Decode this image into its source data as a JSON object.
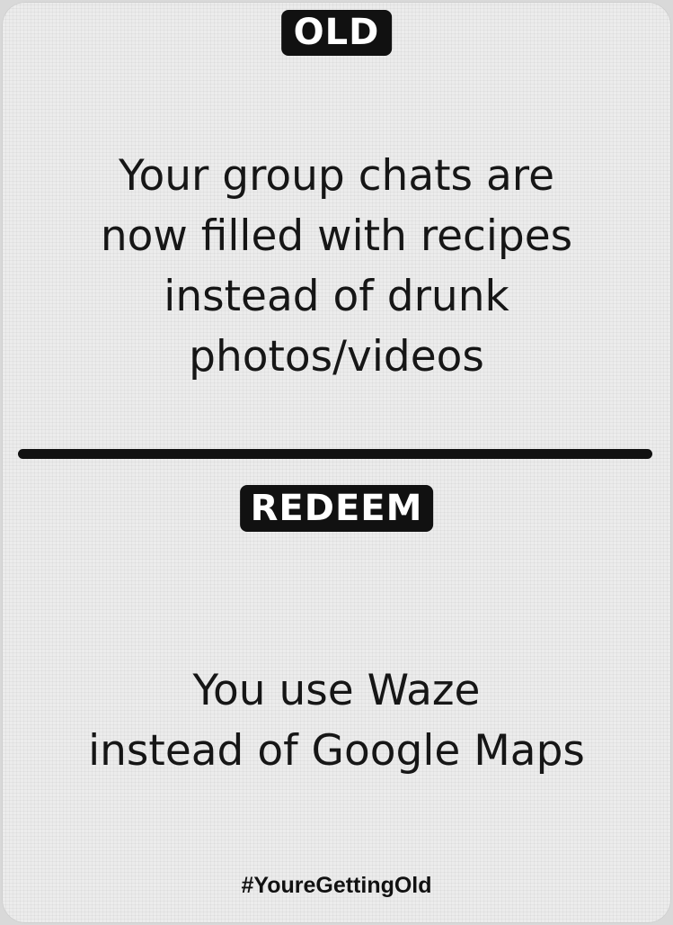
{
  "card": {
    "old_label": "OLD",
    "old_text": "Your group chats are\nnow filled with recipes\ninstead of drunk\nphotos/videos",
    "redeem_label": "REDEEM",
    "redeem_text": "You use Waze\ninstead of Google Maps",
    "hashtag": "#YoureGettingOld"
  },
  "colors": {
    "ink": "#111111",
    "card_background": "#ececec",
    "label_text": "#ffffff"
  }
}
